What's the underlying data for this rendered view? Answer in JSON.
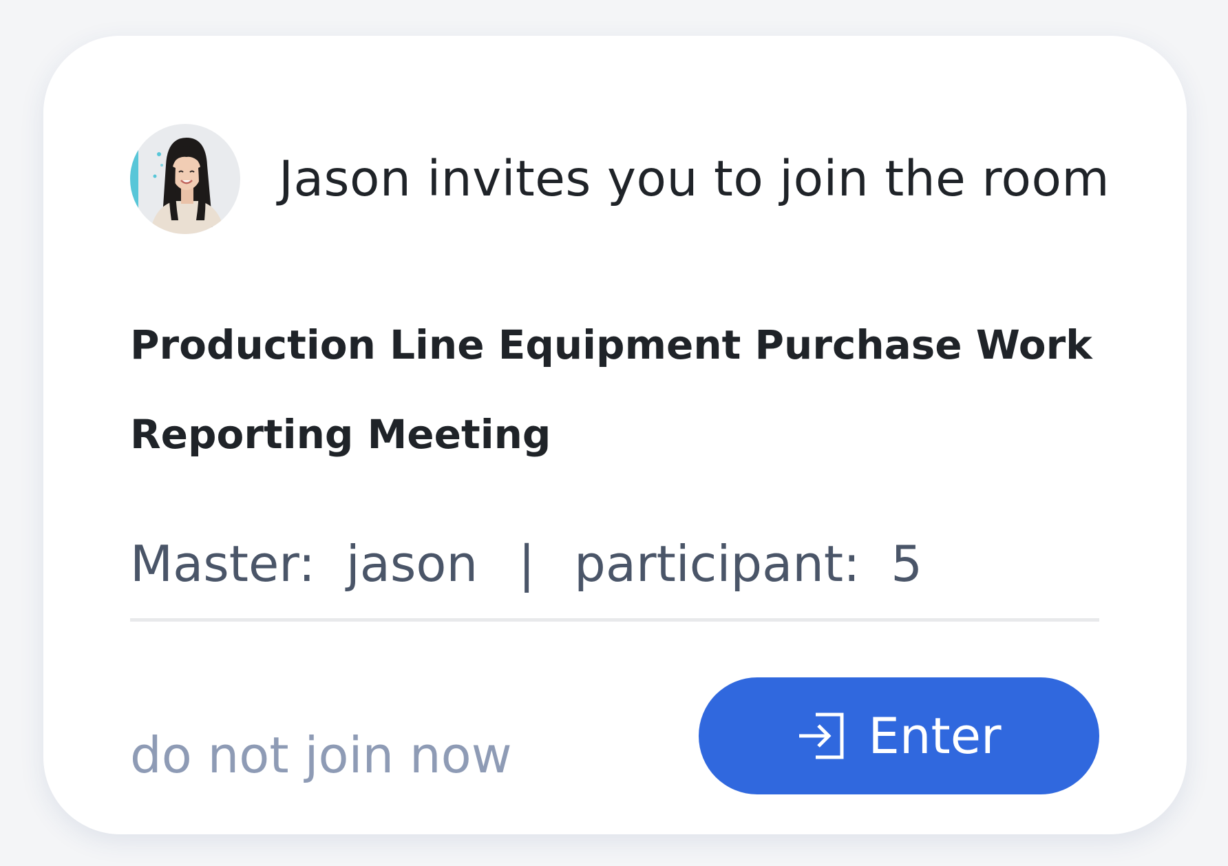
{
  "invitation": {
    "title": "Jason invites you to join the room",
    "room_name_line1": "Production Line Equipment Purchase Work",
    "room_name_line2": "Reporting Meeting",
    "master_label": "Master:",
    "master_value": "jason",
    "separator": "|",
    "participant_label": "participant:",
    "participant_value": "5"
  },
  "actions": {
    "decline_label": "do not join now",
    "enter_label": "Enter"
  },
  "icons": {
    "avatar": "user-avatar",
    "enter": "enter-icon"
  },
  "colors": {
    "primary": "#3068de",
    "title_text": "#1f2328",
    "meta_text": "#4a5568",
    "secondary_text": "#8e9bb5",
    "divider": "#e8e9eb"
  }
}
